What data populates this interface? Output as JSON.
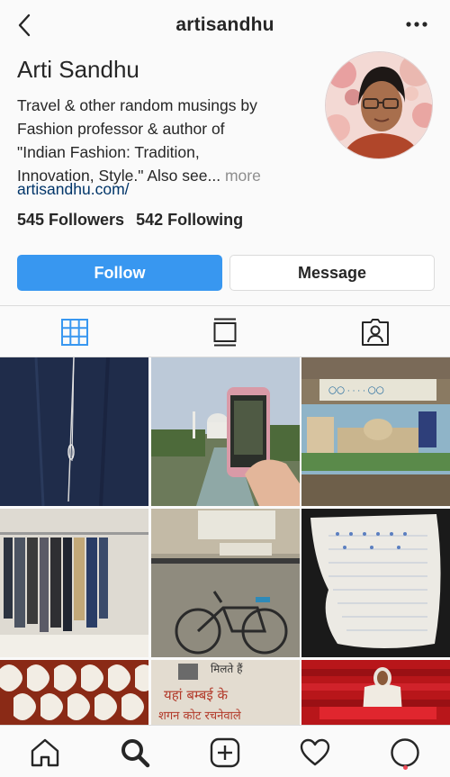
{
  "header": {
    "username": "artisandhu",
    "back_icon": "chevron-left-icon",
    "more_icon": "more-horizontal-icon"
  },
  "profile": {
    "name": "Arti Sandhu",
    "bio_lines": [
      "Travel & other random musings by",
      "Fashion professor & author of",
      "\"Indian Fashion: Tradition,",
      "Innovation, Style.\" Also see..."
    ],
    "more_label": "more",
    "website": "artisandhu.com/",
    "followers": "545 Followers",
    "following": "542 Following"
  },
  "actions": {
    "follow_label": "Follow",
    "message_label": "Message"
  },
  "tabs": [
    {
      "icon": "grid-icon",
      "active": true
    },
    {
      "icon": "feed-icon",
      "active": false
    },
    {
      "icon": "tagged-icon",
      "active": false
    }
  ],
  "bottom_nav": [
    {
      "icon": "home-icon"
    },
    {
      "icon": "search-icon"
    },
    {
      "icon": "add-post-icon"
    },
    {
      "icon": "heart-icon"
    },
    {
      "icon": "profile-icon"
    }
  ],
  "photo_text": {
    "hindi_line1": "मिलते हैं",
    "hindi_line2": "यहां बम्बई के",
    "hindi_line3": "शगन कोट रचनेवाले"
  },
  "colors": {
    "accent": "#3897f0",
    "link": "#003569",
    "secondary_text": "#8e8e8e",
    "border": "#dbdbdb",
    "notification": "#ed4956"
  }
}
